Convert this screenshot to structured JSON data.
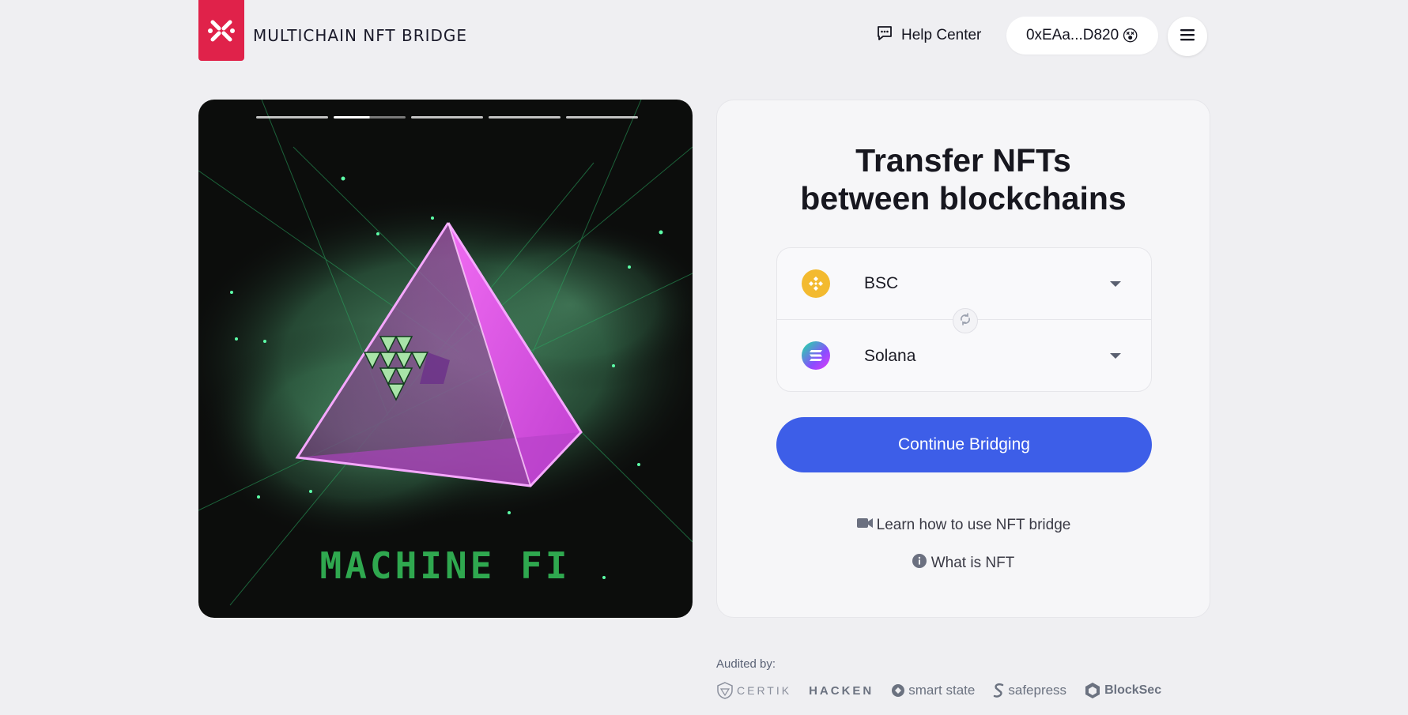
{
  "header": {
    "logo_text": "MULTICHAIN NFT BRIDGE",
    "help_label": "Help Center",
    "wallet_address": "0xEAa...D820",
    "wallet_emoji": "😵"
  },
  "carousel": {
    "slide_count": 5,
    "active_index": 1,
    "image_caption": "MACHINE FI"
  },
  "card": {
    "title_line1": "Transfer NFTs",
    "title_line2": "between blockchains",
    "from_chain": "BSC",
    "to_chain": "Solana",
    "continue_label": "Continue Bridging",
    "learn_label": "Learn how to use NFT bridge",
    "whatis_label": "What is NFT"
  },
  "audit": {
    "label": "Audited by:",
    "auditors": [
      "CERTIK",
      "HACKEN",
      "smart state",
      "safepress",
      "BlockSec"
    ]
  },
  "colors": {
    "accent": "#3d5ee8",
    "logo": "#e0224a",
    "bsc": "#f3ba2f"
  }
}
